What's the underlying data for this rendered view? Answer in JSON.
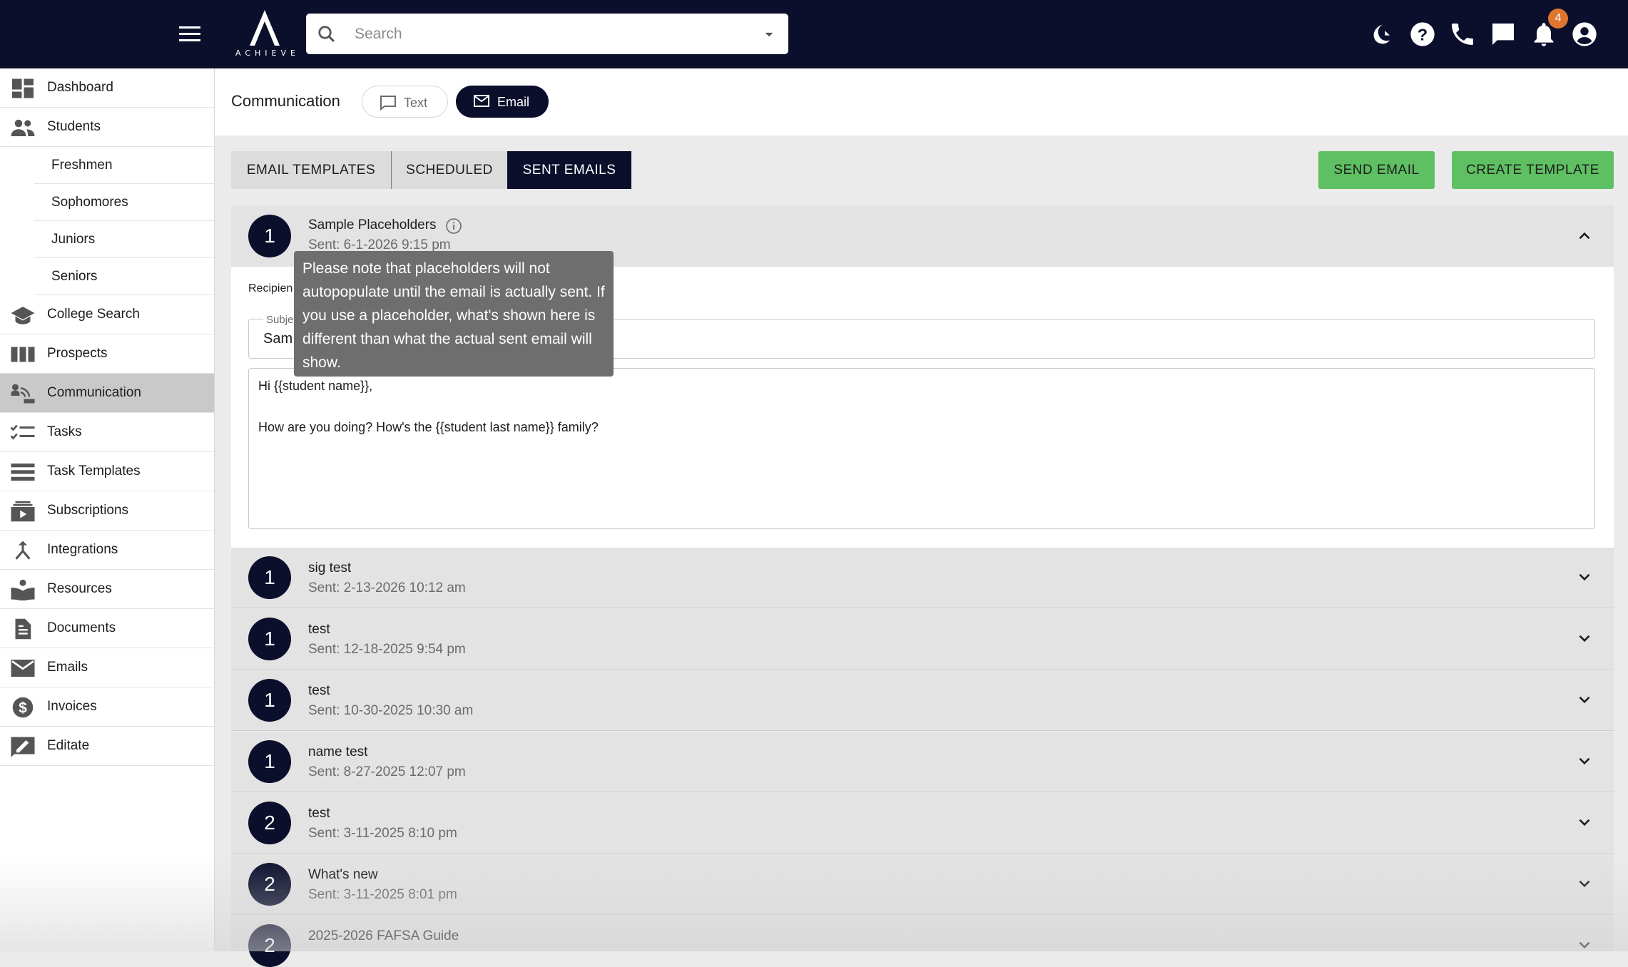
{
  "app": {
    "logo_text": "ACHIEVE",
    "search_placeholder": "Search",
    "notification_count": "4"
  },
  "colors": {
    "navy": "#0b0f2c",
    "green": "#5ec062",
    "badge": "#e0762d",
    "active_nav": "#c9c9c9"
  },
  "sidebar": {
    "items": [
      {
        "label": "Dashboard",
        "icon": "dashboard-icon"
      },
      {
        "label": "Students",
        "icon": "people-icon"
      },
      {
        "label": "Freshmen"
      },
      {
        "label": "Sophomores"
      },
      {
        "label": "Juniors"
      },
      {
        "label": "Seniors"
      },
      {
        "label": "College Search",
        "icon": "graduation-cap-icon"
      },
      {
        "label": "Prospects",
        "icon": "columns-icon"
      },
      {
        "label": "Communication",
        "icon": "communication-icon"
      },
      {
        "label": "Tasks",
        "icon": "checklist-icon"
      },
      {
        "label": "Task Templates",
        "icon": "list-icon"
      },
      {
        "label": "Subscriptions",
        "icon": "subscriptions-icon"
      },
      {
        "label": "Integrations",
        "icon": "merge-icon"
      },
      {
        "label": "Resources",
        "icon": "book-reader-icon"
      },
      {
        "label": "Documents",
        "icon": "document-icon"
      },
      {
        "label": "Emails",
        "icon": "mail-icon"
      },
      {
        "label": "Invoices",
        "icon": "dollar-icon"
      },
      {
        "label": "Editate",
        "icon": "edit-icon"
      }
    ]
  },
  "header": {
    "title": "Communication",
    "text_label": "Text",
    "email_label": "Email"
  },
  "tabs": [
    "EMAIL TEMPLATES",
    "SCHEDULED",
    "SENT EMAILS"
  ],
  "actions": {
    "send": "SEND EMAIL",
    "create": "CREATE TEMPLATE"
  },
  "expanded": {
    "count": "1",
    "title": "Sample Placeholders",
    "sent": "Sent: 6-1-2026 9:15 pm",
    "recipients_label": "Recipien",
    "subject_label": "Subje",
    "subject_value": "Sam",
    "body_line1": "Hi {{student name}},",
    "body_line2": "How are you doing? How's the {{student last name}} family?",
    "tooltip": "Please note that placeholders will not autopopulate until the email is actually sent. If you use a placeholder, what's shown here is different than what the actual sent email will show."
  },
  "emails": [
    {
      "count": "1",
      "title": "sig test",
      "sent": "Sent: 2-13-2026 10:12 am"
    },
    {
      "count": "1",
      "title": "test",
      "sent": "Sent: 12-18-2025 9:54 pm"
    },
    {
      "count": "1",
      "title": "test",
      "sent": "Sent: 10-30-2025 10:30 am"
    },
    {
      "count": "1",
      "title": "name test",
      "sent": "Sent: 8-27-2025 12:07 pm"
    },
    {
      "count": "2",
      "title": "test",
      "sent": "Sent: 3-11-2025 8:10 pm"
    },
    {
      "count": "2",
      "title": "What's new",
      "sent": "Sent: 3-11-2025 8:01 pm"
    },
    {
      "count": "2",
      "title": "2025-2026 FAFSA Guide",
      "sent": ""
    }
  ]
}
